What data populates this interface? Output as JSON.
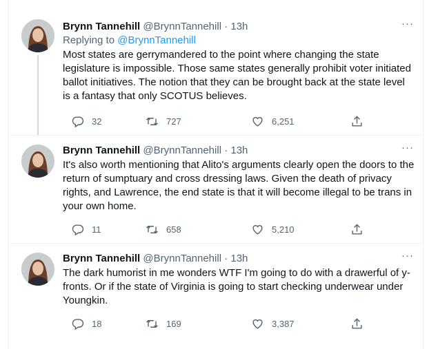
{
  "tweets": [
    {
      "author": {
        "name": "Brynn Tannehill",
        "handle": "@BrynnTannehill",
        "time": "13h"
      },
      "replying_label": "Replying to",
      "replying_to": "@BrynnTannehill",
      "text": "Most states are gerrymandered to the point where changing the state legislature is impossible. Those same states generally prohibit voter initiated ballot initiatives. The notion that they can be brought back at the state level is a fantasy that only SCOTUS believes.",
      "replies": "32",
      "retweets": "727",
      "likes": "6,251"
    },
    {
      "author": {
        "name": "Brynn Tannehill",
        "handle": "@BrynnTannehill",
        "time": "13h"
      },
      "text": "It's also worth mentioning that Alito's arguments clearly open the doors to the return of sumptuary and cross dressing laws. Given the death of privacy rights, and Lawrence, the end state is that it will become illegal to be trans in your own home.",
      "replies": "11",
      "retweets": "658",
      "likes": "5,210"
    },
    {
      "author": {
        "name": "Brynn Tannehill",
        "handle": "@BrynnTannehill",
        "time": "13h"
      },
      "text": "The dark humorist in me wonders WTF I'm going to do with a drawerful of y-fronts. Or if the state of Virginia is going to start checking underwear under Youngkin.",
      "replies": "18",
      "retweets": "169",
      "likes": "3,387"
    }
  ],
  "separator": "·",
  "more_glyph": "···",
  "colors": {
    "accent": "#1d9bf0",
    "secondary_text": "#536471",
    "divider": "#eff3f4"
  }
}
